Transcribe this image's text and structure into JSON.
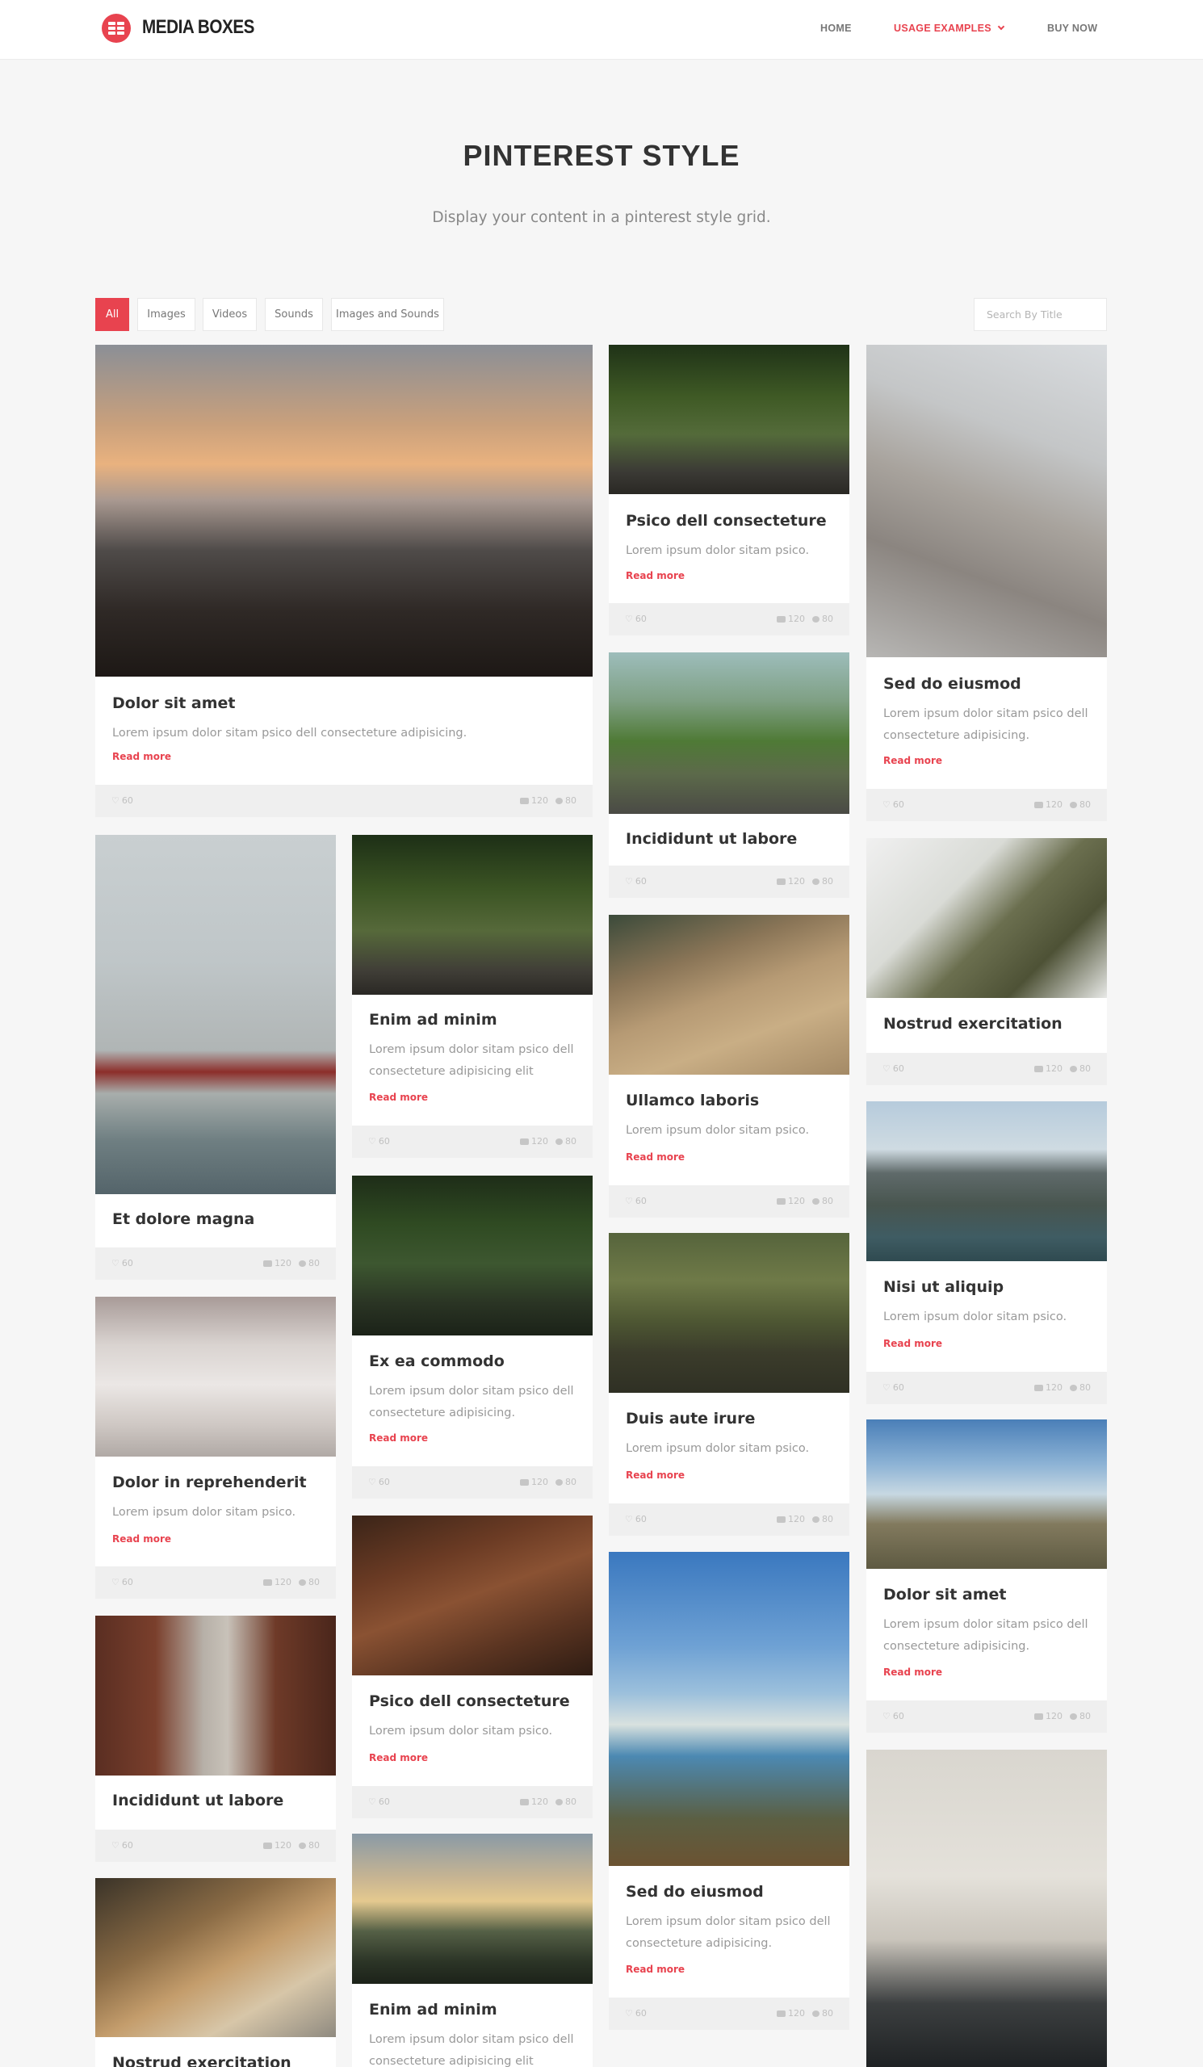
{
  "header": {
    "brand": "MEDIA BOXES",
    "nav": {
      "home": "HOME",
      "usage": "USAGE EXAMPLES",
      "buy": "BUY NOW"
    }
  },
  "hero": {
    "title_light": "PINTEREST ",
    "title_bold": "STYLE",
    "subtitle": "Display your content in a pinterest style grid."
  },
  "filters": {
    "all": "All",
    "images": "Images",
    "videos": "Videos",
    "sounds": "Sounds",
    "images_sounds": "Images and Sounds"
  },
  "search": {
    "placeholder": "Search By Title"
  },
  "stats": {
    "likes": "60",
    "photos": "120",
    "comments": "80"
  },
  "cards": [
    {
      "title": "Dolor sit amet",
      "desc": "Lorem ipsum dolor sitam psico dell consecteture adipisicing.",
      "read": "Read more"
    },
    {
      "title": "Psico dell consecteture",
      "desc": "Lorem ipsum dolor sitam psico.",
      "read": "Read more"
    },
    {
      "title": "Sed do eiusmod",
      "desc": "Lorem ipsum dolor sitam psico dell consecteture adipisicing.",
      "read": "Read more"
    },
    {
      "title": "Incididunt ut labore"
    },
    {
      "title": "Nostrud exercitation"
    },
    {
      "title": "Et dolore magna"
    },
    {
      "title": "Enim ad minim",
      "desc": "Lorem ipsum dolor sitam psico dell consecteture adipisicing elit",
      "read": "Read more"
    },
    {
      "title": "Ullamco laboris",
      "desc": "Lorem ipsum dolor sitam psico.",
      "read": "Read more"
    },
    {
      "title": "Nisi ut aliquip",
      "desc": "Lorem ipsum dolor sitam psico.",
      "read": "Read more"
    },
    {
      "title": "Ex ea commodo",
      "desc": "Lorem ipsum dolor sitam psico dell consecteture adipisicing.",
      "read": "Read more"
    },
    {
      "title": "Duis aute irure",
      "desc": "Lorem ipsum dolor sitam psico.",
      "read": "Read more"
    },
    {
      "title": "Dolor in reprehenderit",
      "desc": "Lorem ipsum dolor sitam psico.",
      "read": "Read more"
    },
    {
      "title": "Dolor sit amet",
      "desc": "Lorem ipsum dolor sitam psico dell consecteture adipisicing.",
      "read": "Read more"
    },
    {
      "title": "Psico dell consecteture",
      "desc": "Lorem ipsum dolor sitam psico.",
      "read": "Read more"
    },
    {
      "title": "Incididunt ut labore"
    },
    {
      "title": "Sed do eiusmod",
      "desc": "Lorem ipsum dolor sitam psico dell consecteture adipisicing.",
      "read": "Read more"
    },
    {
      "title": "Enim ad minim",
      "desc": "Lorem ipsum dolor sitam psico dell consecteture adipisicing elit"
    },
    {
      "title": "Nostrud exercitation"
    }
  ],
  "colors": {
    "accent": "#e8434f",
    "background": "#f6f6f6",
    "footer": "#efefef"
  }
}
